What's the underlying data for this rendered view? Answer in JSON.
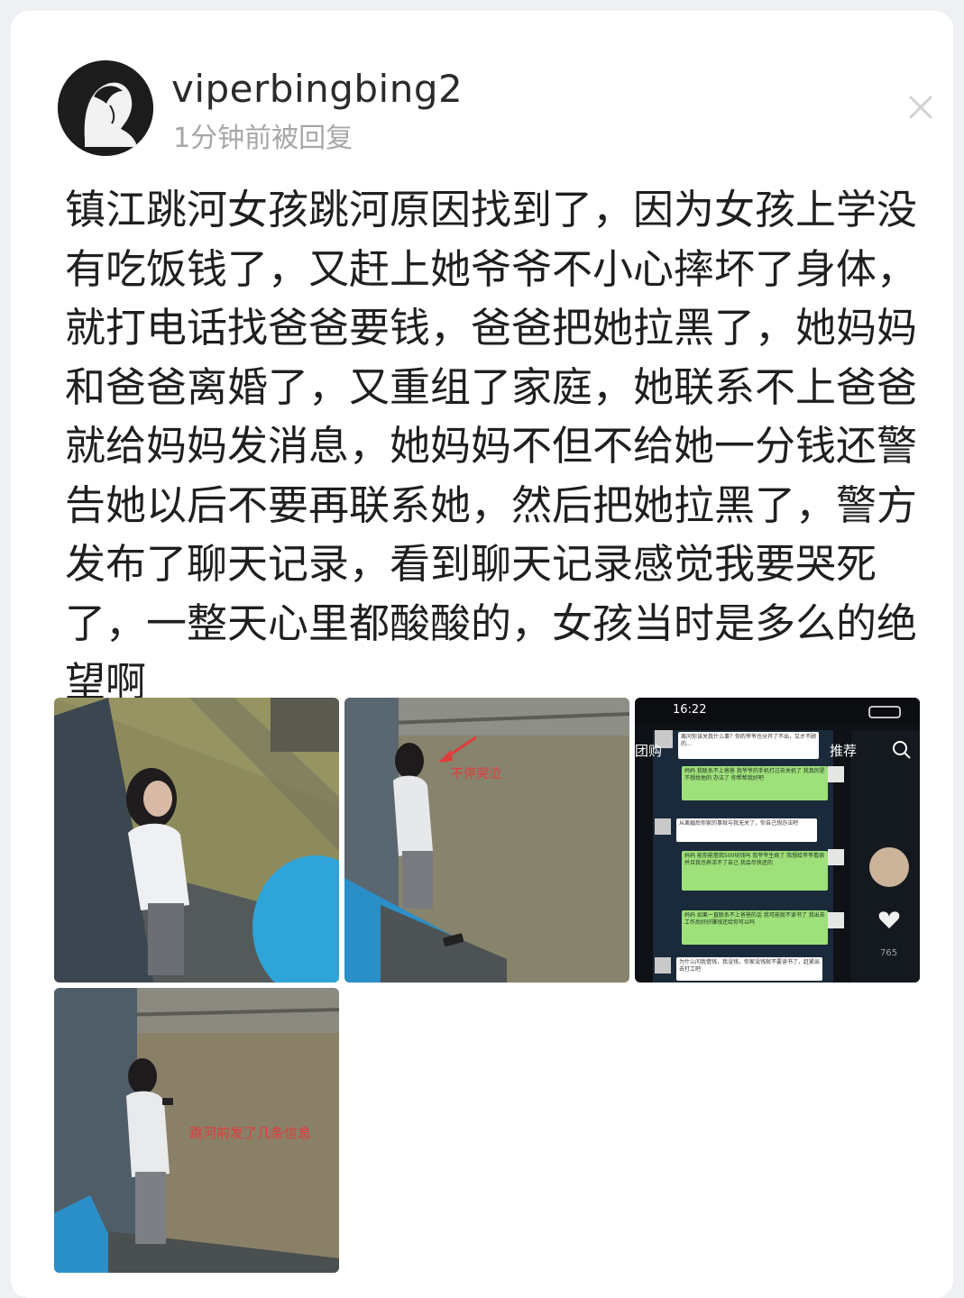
{
  "post": {
    "username": "viperbingbing2",
    "reply_time": "1分钟前被回复",
    "text": "镇江跳河女孩跳河原因找到了，因为女孩上学没有吃饭钱了，又赶上她爷爷不小心摔坏了身体，就打电话找爸爸要钱，爸爸把她拉黑了，她妈妈和爸爸离婚了，又重组了家庭，她联系不上爸爸就给妈妈发消息，她妈妈不但不给她一分钱还警告她以后不要再联系她，然后把她拉黑了，警方发布了聊天记录，看到聊天记录感觉我要哭死了，一整天心里都酸酸的，女孩当时是多么的绝望啊"
  },
  "icons": {
    "close": "close-icon",
    "avatar": "avatar-silhouette"
  },
  "images": {
    "photo2_caption": "不停哭泣",
    "photo4_caption": "跳河前发了几条信息",
    "phone": {
      "time": "16:22",
      "tab_left": "团购",
      "tab_right": "推荐",
      "likes": "765",
      "messages": [
        {
          "side": "white",
          "text": "离问你该关我什么事？你的爷爷也分开了不出，又才不顾的…"
        },
        {
          "side": "green",
          "text": "妈妈 我联系不上爸爸 我爷爷的手机打过去关机了 我真的是不想找他的 办法了 你帮帮我好吧"
        },
        {
          "side": "white",
          "text": "从离婚后你家的事就与我无关了，你自己想办法吧"
        },
        {
          "side": "green",
          "text": "妈妈 能你能借我500块钱吗 我爷爷生病了 我想给爷爷看病 并且我也养活不了自己 我会尽快还的"
        },
        {
          "side": "green",
          "text": "妈妈 如果一直联系不上爸爸的话 我可能就不读书了 我出去工作后好好赚钱还给你可以吗"
        },
        {
          "side": "white",
          "text": "为什么问我借钱，我没钱，你家没钱就不要读书了，赶紧出去打工吧"
        }
      ]
    }
  },
  "colors": {
    "background": "#eef0f3",
    "card": "#ffffff",
    "text": "#1f1f1f",
    "muted": "#a7a7a7",
    "annotation_red": "#e23b3b",
    "wechat_green": "#9ee07a"
  }
}
